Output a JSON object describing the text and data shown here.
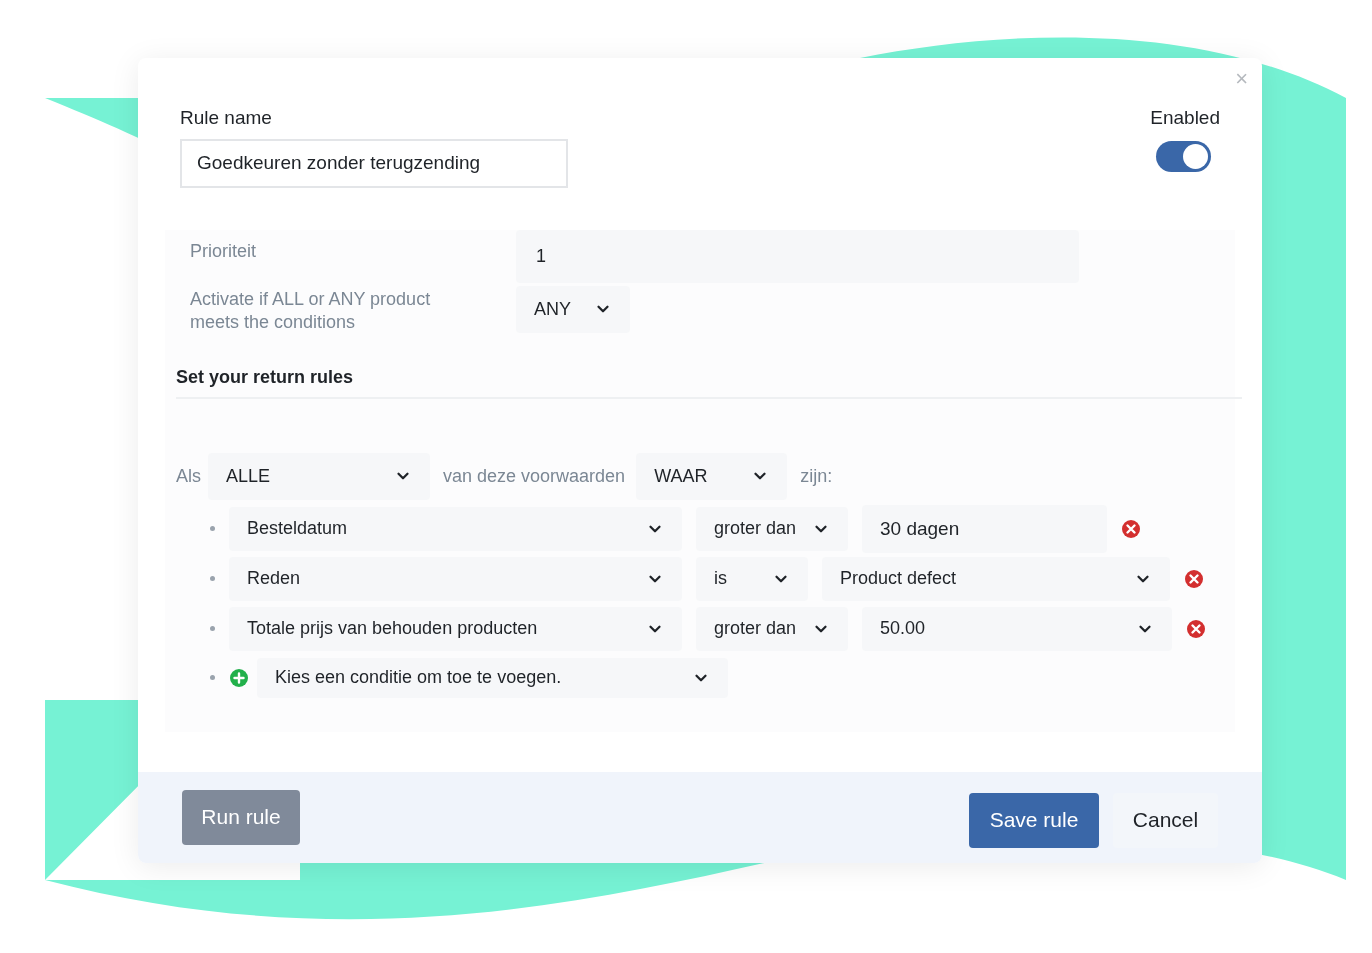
{
  "dialog": {
    "close": "×",
    "rule_name": {
      "label": "Rule name",
      "value": "Goedkeuren zonder terugzending"
    },
    "enabled": {
      "label": "Enabled",
      "on": true
    },
    "priority": {
      "label": "Prioriteit",
      "value": "1"
    },
    "activate": {
      "label": "Activate if ALL or ANY product meets the conditions",
      "value": "ANY"
    },
    "section_title": "Set your return rules",
    "condition_header": {
      "prefix": "Als",
      "quantifier": "ALLE",
      "middle": "van deze voorwaarden",
      "truth": "WAAR",
      "suffix": "zijn:"
    },
    "conditions": [
      {
        "field": "Besteldatum",
        "operator": "groter dan",
        "value": "30 dagen",
        "kind": "text"
      },
      {
        "field": "Reden",
        "operator": "is",
        "value": "Product defect",
        "kind": "select"
      },
      {
        "field": "Totale prijs van behouden producten",
        "operator": "groter dan",
        "value": "50.00",
        "kind": "select"
      }
    ],
    "add_condition": "Kies een conditie om toe te voegen.",
    "buttons": {
      "run": "Run rule",
      "save": "Save rule",
      "cancel": "Cancel"
    }
  }
}
